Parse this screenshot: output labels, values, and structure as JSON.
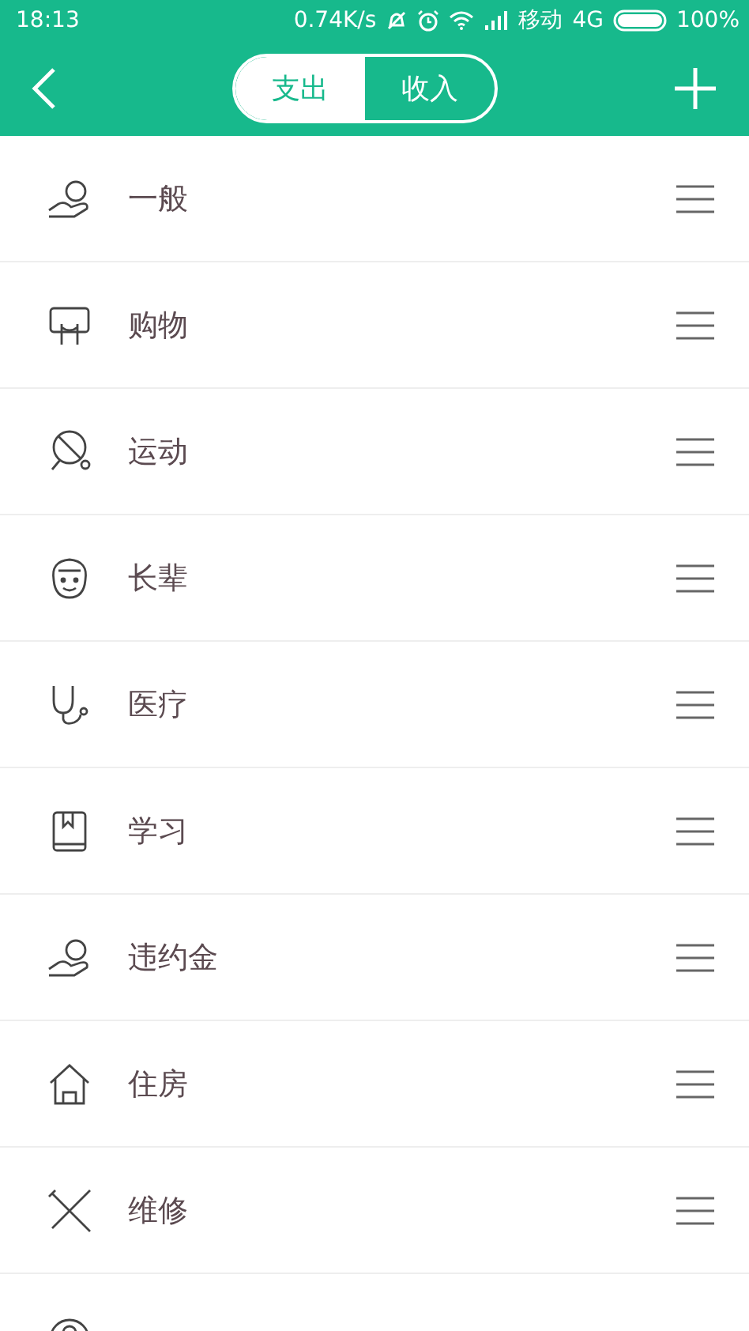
{
  "status_bar": {
    "time": "18:13",
    "speed": "0.74K/s",
    "carrier": "移动",
    "network": "4G",
    "battery": "100%"
  },
  "header": {
    "tabs": [
      {
        "label": "支出",
        "selected": true
      },
      {
        "label": "收入",
        "selected": false
      }
    ]
  },
  "categories": [
    {
      "label": "一般"
    },
    {
      "label": "购物"
    },
    {
      "label": "运动"
    },
    {
      "label": "长辈"
    },
    {
      "label": "医疗"
    },
    {
      "label": "学习"
    },
    {
      "label": "违约金"
    },
    {
      "label": "住房"
    },
    {
      "label": "维修"
    },
    {
      "kind": "partial"
    }
  ]
}
